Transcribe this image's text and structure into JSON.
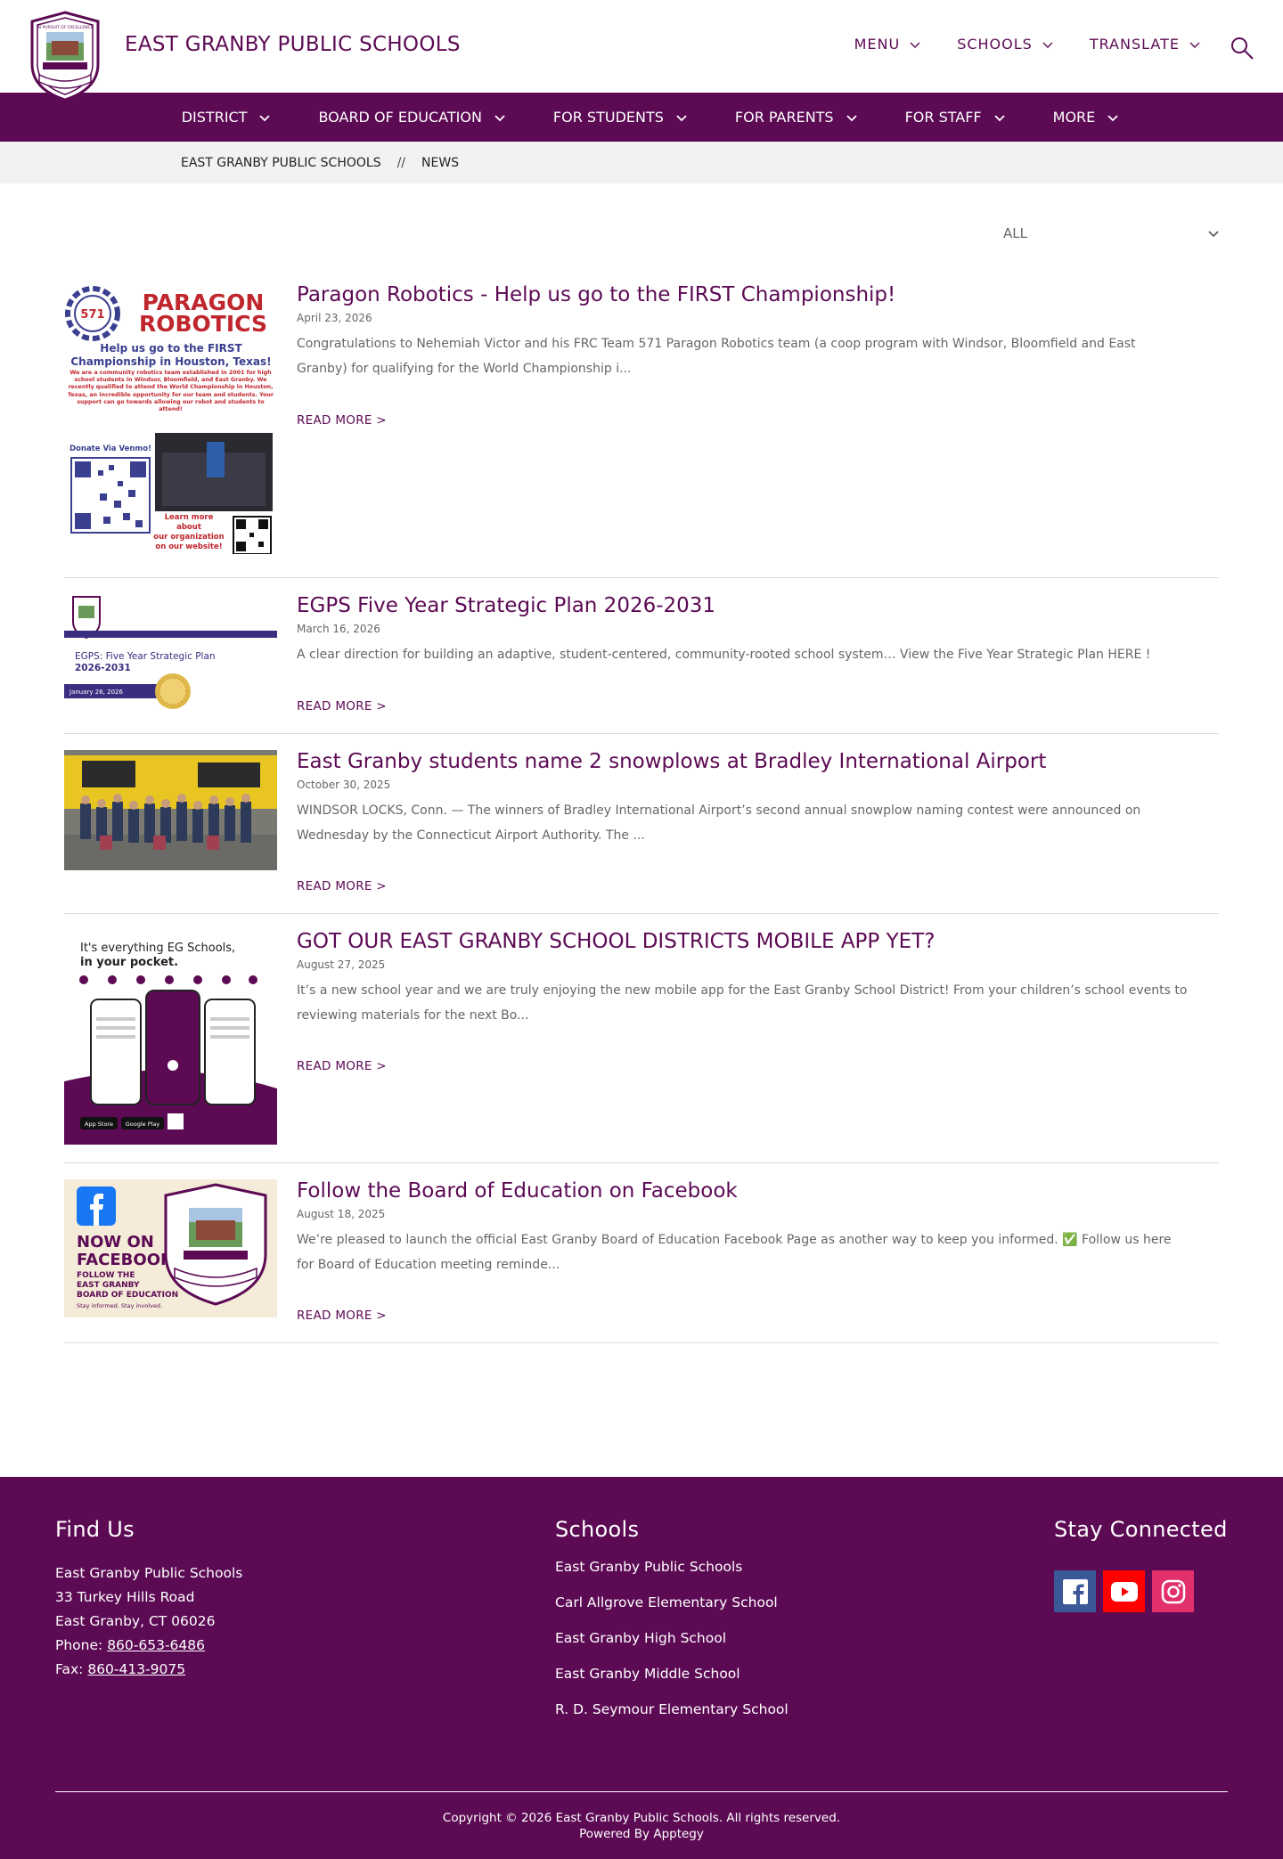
{
  "header": {
    "title": "EAST GRANBY PUBLIC SCHOOLS",
    "logo_text": "IN PURSUIT OF EXCELLENCE",
    "util_nav": [
      "MENU",
      "SCHOOLS",
      "TRANSLATE"
    ]
  },
  "main_nav": [
    "DISTRICT",
    "BOARD OF EDUCATION",
    "FOR STUDENTS",
    "FOR PARENTS",
    "FOR STAFF",
    "MORE"
  ],
  "breadcrumb": {
    "home": "EAST GRANBY PUBLIC SCHOOLS",
    "separator": "//",
    "current": "NEWS"
  },
  "filter": {
    "selected": "ALL"
  },
  "news": [
    {
      "title": "Paragon Robotics - Help us go to the FIRST Championship!",
      "date": "April 23, 2026",
      "excerpt": "Congratulations to Nehemiah Victor and his FRC Team 571 Paragon Robotics team (a coop program with Windsor, Bloomfield and East Granby) for qualifying for the World Championship i...",
      "read_more": "READ MORE >",
      "thumb": {
        "badge": "571",
        "heading": [
          "PARAGON",
          "ROBOTICS"
        ],
        "sub": [
          "Help us go to the FIRST",
          "Championship in Houston, Texas!"
        ],
        "body": "We are a community robotics team established in 2001 for high school students in Windsor, Bloomfield, and East Granby. We recently qualified to attend the World Championship in Houston, Texas, an incredible opportunity for our team and students. Your support can go towards allowing our robot and students to attend!",
        "donate": "Donate Via Venmo!",
        "learn": [
          "Learn more about",
          "our organization",
          "on our website!"
        ]
      }
    },
    {
      "title": "EGPS Five Year Strategic Plan 2026-2031",
      "date": "March 16, 2026",
      "excerpt": "A clear direction for building an adaptive, student-centered, community-rooted school system… View the Five Year Strategic Plan HERE !",
      "read_more": "READ MORE >",
      "thumb": {
        "heading": [
          "EGPS: Five Year Strategic Plan",
          "2026-2031"
        ],
        "date": "January 26, 2026"
      }
    },
    {
      "title": "East Granby students name 2 snowplows at Bradley International Airport",
      "date": "October 30, 2025",
      "excerpt": "WINDSOR LOCKS, Conn. — The winners of Bradley International Airport’s second annual snowplow naming contest were announced on Wednesday by the Connecticut Airport Authority. The ...",
      "read_more": "READ MORE >"
    },
    {
      "title": "GOT OUR EAST GRANBY SCHOOL DISTRICTS MOBILE APP YET?",
      "date": "August 27, 2025",
      "excerpt": "It’s a new school year and we are truly enjoying the new mobile app for the East Granby School District! From your children’s school events to reviewing materials for the next Bo...",
      "read_more": "READ MORE >",
      "thumb": {
        "line1": "It's everything EG Schools,",
        "line2": "in your pocket.",
        "store1": "App Store",
        "store2": "Google Play"
      }
    },
    {
      "title": "Follow the Board of Education on Facebook",
      "date": "August 18, 2025",
      "excerpt": "We’re pleased to launch the official East Granby Board of Education Facebook Page as another way to keep you informed. ✅ Follow us here for Board of Education meeting reminde...",
      "read_more": "READ MORE >",
      "thumb": {
        "heading": [
          "NOW ON",
          "FACEBOOK!"
        ],
        "sub": [
          "FOLLOW THE",
          "EAST GRANBY",
          "BOARD OF EDUCATION"
        ],
        "tag": "Stay informed. Stay involved."
      }
    }
  ],
  "footer": {
    "find_us": {
      "heading": "Find Us",
      "name": "East Granby Public Schools",
      "street": "33 Turkey Hills Road",
      "city": "East Granby, CT 06026",
      "phone_label": "Phone:",
      "phone": "860-653-6486",
      "fax_label": "Fax:",
      "fax": "860-413-9075"
    },
    "schools": {
      "heading": "Schools",
      "items": [
        "East Granby Public Schools",
        "Carl Allgrove Elementary School",
        "East Granby High School",
        "East Granby Middle School",
        "R. D. Seymour Elementary School"
      ]
    },
    "stay_connected": {
      "heading": "Stay Connected",
      "icons": [
        "facebook-icon",
        "youtube-icon",
        "instagram-icon"
      ]
    },
    "copyright": "Copyright © 2026 East Granby Public Schools. All rights reserved.",
    "powered_by": "Powered By Apptegy"
  },
  "colors": {
    "brand": "#5c0a54",
    "facebook": "#3b5998",
    "youtube": "#ff0000",
    "instagram": "#e1306c"
  }
}
